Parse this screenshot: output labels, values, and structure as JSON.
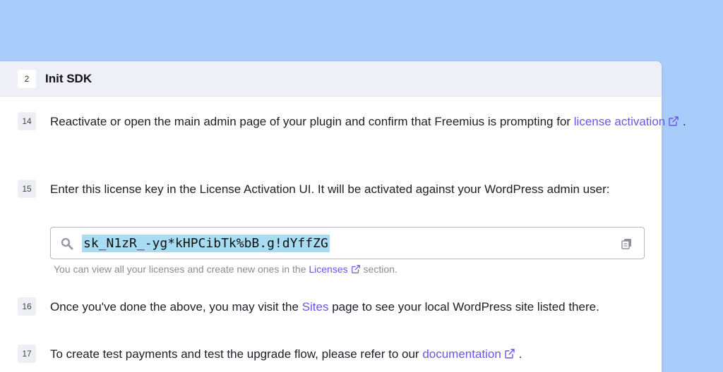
{
  "colors": {
    "background": "#a9cdfb",
    "link": "#6a55e8",
    "key_highlight": "#a8dcf2",
    "header_bg": "#efeff8"
  },
  "section": {
    "number": "2",
    "title": "Init SDK"
  },
  "steps": [
    {
      "number": "14",
      "text_before": "Reactivate or open the main admin page of your plugin and confirm that Freemius is prompting for ",
      "link_label": "license activation",
      "text_after": " ."
    },
    {
      "number": "15",
      "text": "Enter this license key in the License Activation UI. It will be activated against your WordPress admin user:",
      "license_key": "sk_N1zR_-yg*kHPCibTk%bB.g!dYffZG",
      "hint_before": "You can view all your licenses and create new ones in the ",
      "hint_link": "Licenses",
      "hint_after": " section."
    },
    {
      "number": "16",
      "text_before": "Once you've done the above, you may visit the ",
      "link_label": "Sites",
      "text_after": " page to see your local WordPress site listed there."
    },
    {
      "number": "17",
      "text_before": "To create test payments and test the upgrade flow, please refer to our ",
      "link_label": "documentation",
      "text_after": " ."
    }
  ],
  "icons": {
    "external": "external-link-icon",
    "search": "search-icon",
    "copy": "copy-icon"
  }
}
